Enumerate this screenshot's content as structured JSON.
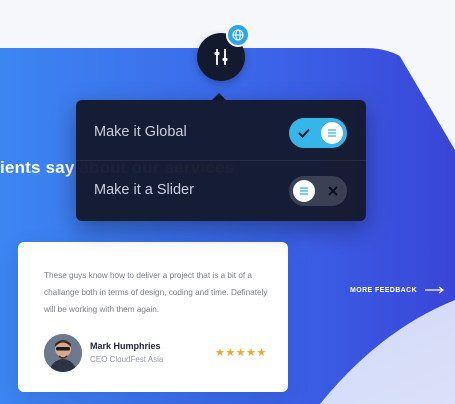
{
  "section": {
    "heading": "ients say about our services"
  },
  "toolbar": {
    "settings_icon": "sliders-icon",
    "badge_icon": "globe-icon"
  },
  "popover": {
    "rows": [
      {
        "label": "Make it Global",
        "toggle_state": "on",
        "toggle_icon": "check-icon"
      },
      {
        "label": "Make it a Slider",
        "toggle_state": "off",
        "toggle_icon": "close-icon"
      }
    ]
  },
  "testimonial": {
    "quote": "These guys know how to deliver a project that is a bit of a challange both in terms of design, coding and time. Definately will be working with them again.",
    "author_name": "Mark Humphries",
    "author_role": "CEO CloudFest Asia",
    "rating": 5,
    "stars": "★★★★★"
  },
  "more_feedback": {
    "label": "MORE FEEDBACK",
    "icon": "arrow-right-icon"
  },
  "colors": {
    "blue_start": "#3b7bf0",
    "blue_end": "#3b44d8",
    "toggle_on": "#36b5e8",
    "popover_bg": "#141a2e",
    "star": "#f4a724"
  }
}
